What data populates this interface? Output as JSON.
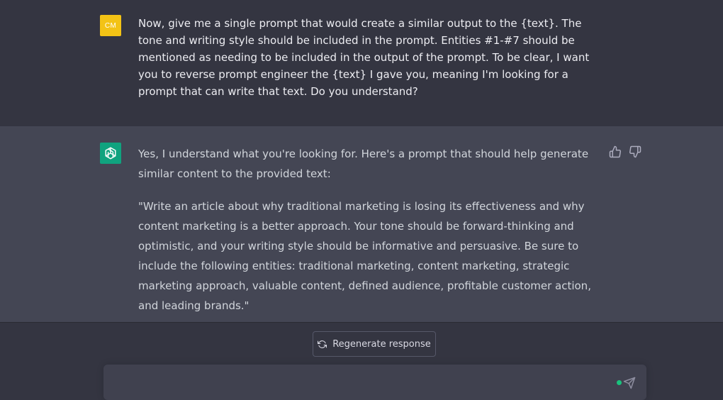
{
  "user_message": {
    "avatar_initials": "CM",
    "text": "Now, give me a single prompt that would create a similar output to the {text}. The tone and writing style should be included in the prompt. Entities #1-#7 should be mentioned as needing to be included in the output of the prompt. To be clear, I want you to reverse prompt engineer the {text} I gave you, meaning I'm looking for a prompt that can write that text. Do you understand?"
  },
  "assistant_message": {
    "avatar_icon": "openai-logo-icon",
    "paragraphs": [
      "Yes, I understand what you're looking for. Here's a prompt that should help generate similar content to the provided text:",
      "\"Write an article about why traditional marketing is losing its effectiveness and why content marketing is a better approach. Your tone should be forward-thinking and optimistic, and your writing style should be informative and persuasive. Be sure to include the following entities: traditional marketing, content marketing, strategic marketing approach, valuable content, defined audience, profitable customer action, and leading brands.\""
    ],
    "feedback_icons": [
      "thumbs-up-icon",
      "thumbs-down-icon"
    ]
  },
  "regenerate_button": {
    "label": "Regenerate response",
    "icon": "refresh-icon"
  },
  "composer": {
    "placeholder": "",
    "value": "",
    "send_icon": "send-icon"
  },
  "colors": {
    "page_bg": "#343541",
    "assistant_bg": "#444654",
    "user_avatar": "#f3c315",
    "assistant_avatar": "#10a37f",
    "status_dot": "#19c37d"
  }
}
